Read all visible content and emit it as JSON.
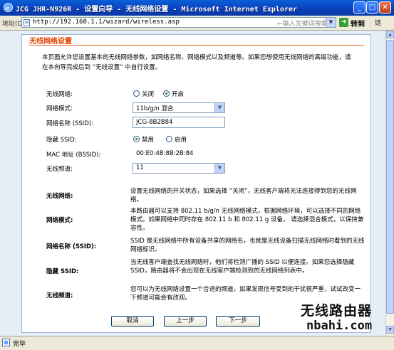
{
  "window": {
    "title": "JCG JHR-N926R - 设置向导 - 无线网络设置 - Microsoft Internet Explorer",
    "min_label": "_",
    "max_label": "□",
    "close_label": "✕"
  },
  "addressbar": {
    "label": "地址(D)",
    "url": "http://192.168.1.1/wizard/wireless.asp",
    "hint": "←输入关键词搜索",
    "go_label": "转到",
    "links_label": "链"
  },
  "status": {
    "text": "完毕"
  },
  "panel": {
    "title": "无线网络设置",
    "intro": "本页面允许您设置基本的无线网络参数，如网络名称、网络模式以及频道等。如果您想使用无线网络的高级功能，请在本向导完成后到 “无线设置” 中自行设置。"
  },
  "form": {
    "wireless_label": "无线网络:",
    "wireless_off": "关闭",
    "wireless_on": "开启",
    "wireless_selected": "开启",
    "mode_label": "网络模式:",
    "mode_value": "11b/g/n 混合",
    "ssid_label": "网络名称 (SSID):",
    "ssid_value": "JCG-8B2B84",
    "hide_label": "隐藏 SSID:",
    "hide_disable": "禁用",
    "hide_enable": "启用",
    "hide_selected": "禁用",
    "mac_label": "MAC 地址 (BSSID):",
    "mac_value": "00:E0:4B:8B:2B:84",
    "channel_label": "无线频道:",
    "channel_value": "11"
  },
  "help": [
    {
      "label": "无线网络:",
      "desc": "设置无线网络的开关状态，如果选择 “关闭”，无线客户端将无法连接得到您的无线网络。"
    },
    {
      "label": "网络模式:",
      "desc": "本路由器可以支持 802.11 b/g/n 无线网络模式，根据网络环境，可以选择不同的网络模式。如果网络中同时存在 802.11 b 和 802.11 g 设备， 请选择混合模式，以保持兼容性。"
    },
    {
      "label": "网络名称 (SSID):",
      "desc": "SSID 是无线网络中所有设备共享的网络名，也就是无线设备扫描无线网络时看到的无线网络标识。"
    },
    {
      "label": "隐藏 SSID:",
      "desc": "当无线客户端查找无线网络时，他们将检测广播的 SSID 以便连接。如果您选择隐藏 SSID，路由器将不会出现在无线客户端检测到的无线网络列表中。"
    },
    {
      "label": "无线频道:",
      "desc": "您可以为无线网络设置一个合适的频道，如果发现信号受到的干扰很严重，试试改变一下频道可能会有改观。"
    }
  ],
  "buttons": {
    "cancel": "取消",
    "prev": "上一步",
    "next": "下一步"
  },
  "watermark": {
    "line1": "无线路由器",
    "line2": "nbahi.com"
  },
  "colors": {
    "title_bar": "#0a4fd0",
    "panel_title": "#e04000",
    "background": "#e5eef6"
  }
}
